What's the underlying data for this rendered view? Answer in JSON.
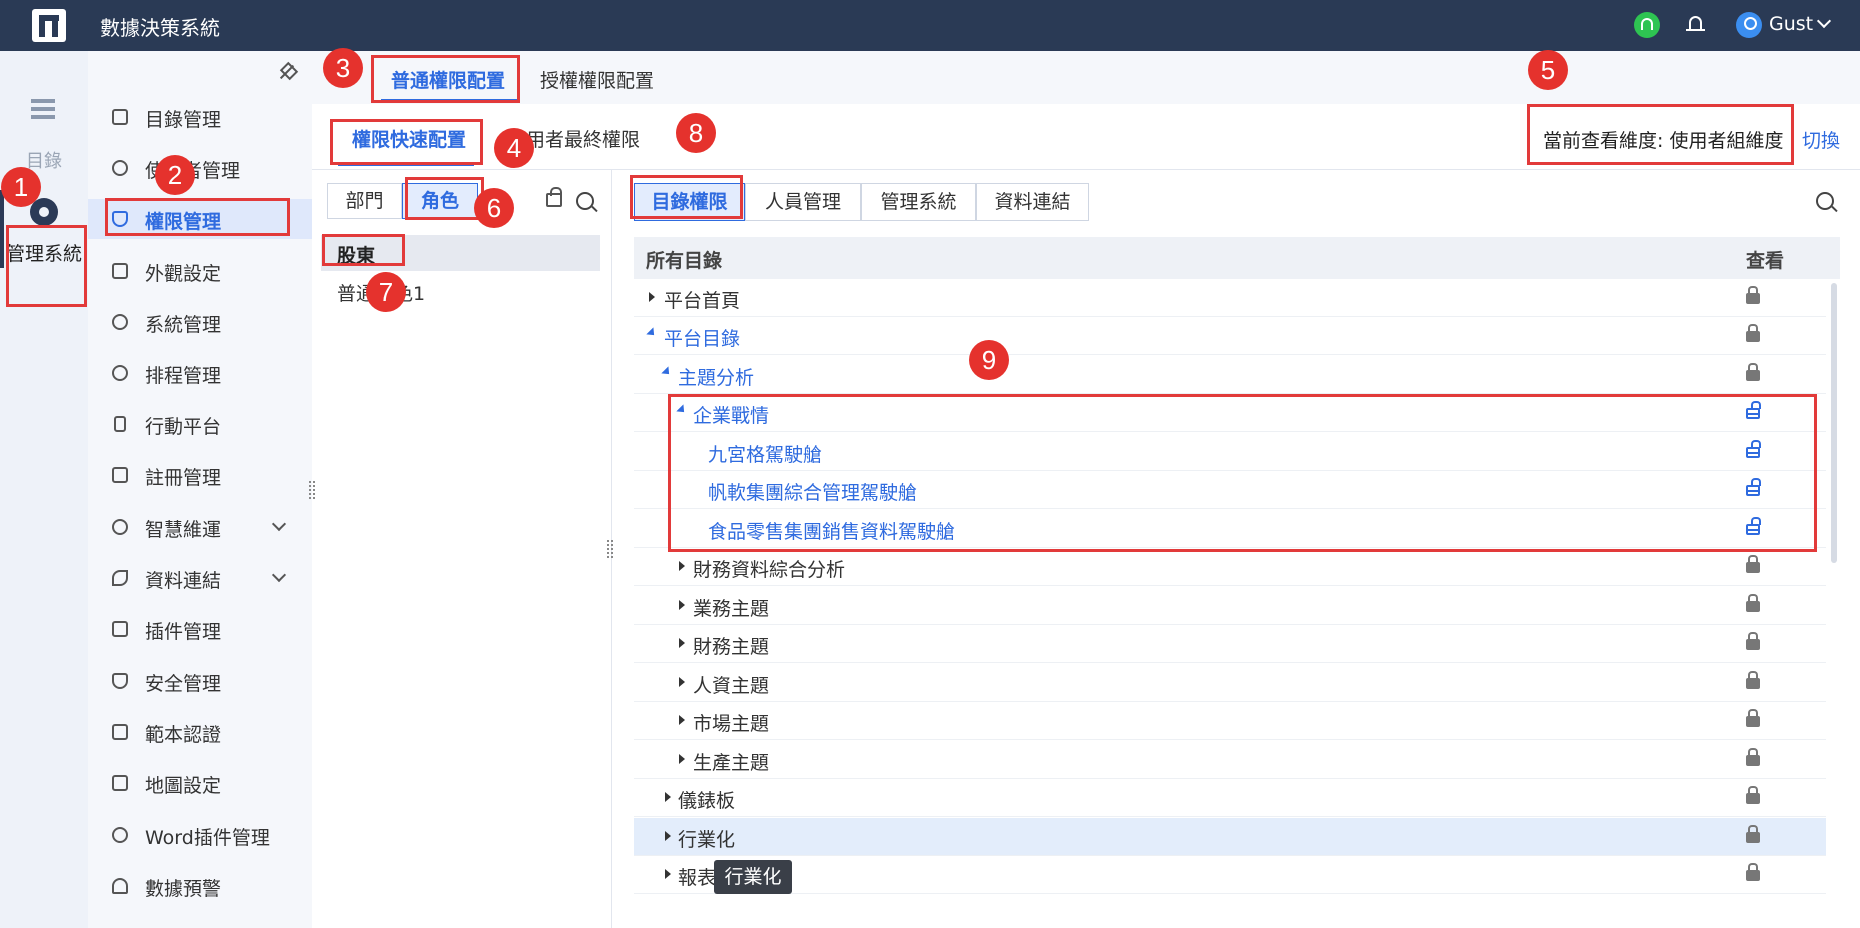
{
  "app": {
    "title": "數據決策系統",
    "user": "Gust"
  },
  "rail": {
    "directory_label": "目錄",
    "system_label": "管理系統"
  },
  "sidebar": {
    "items": [
      {
        "label": "目錄管理"
      },
      {
        "label": "使用者管理"
      },
      {
        "label": "權限管理",
        "active": true
      },
      {
        "label": "外觀設定"
      },
      {
        "label": "系統管理"
      },
      {
        "label": "排程管理"
      },
      {
        "label": "行動平台"
      },
      {
        "label": "註冊管理"
      },
      {
        "label": "智慧維運",
        "expandable": true
      },
      {
        "label": "資料連結",
        "expandable": true
      },
      {
        "label": "插件管理"
      },
      {
        "label": "安全管理"
      },
      {
        "label": "範本認證"
      },
      {
        "label": "地圖設定"
      },
      {
        "label": "Word插件管理"
      },
      {
        "label": "數據預警"
      }
    ]
  },
  "header": {
    "tabs": [
      "普通權限配置",
      "授權權限配置"
    ],
    "subtabs": [
      "權限快速配置",
      "使用者最終權限"
    ],
    "dimension_label": "當前查看維度: 使用者組維度",
    "switch_label": "切換"
  },
  "middle": {
    "segments": [
      "部門",
      "角色"
    ],
    "role_header": "股東",
    "roles": [
      "普通角色1"
    ]
  },
  "right": {
    "tabs": [
      "目錄權限",
      "人員管理",
      "管理系統",
      "資料連結"
    ],
    "columns": [
      "所有目錄",
      "查看"
    ],
    "rows": [
      {
        "label": "平台首頁",
        "level": 0,
        "state": "collapsed",
        "lock": "locked"
      },
      {
        "label": "平台目錄",
        "level": 0,
        "state": "expanded",
        "lock": "locked",
        "blue": true
      },
      {
        "label": "主題分析",
        "level": 1,
        "state": "expanded",
        "lock": "locked",
        "blue": true
      },
      {
        "label": "企業戰情",
        "level": 2,
        "state": "expanded",
        "lock": "open",
        "blue": true
      },
      {
        "label": "九宮格駕駛艙",
        "level": 3,
        "state": "leaf",
        "lock": "open",
        "blue": true
      },
      {
        "label": "帆軟集團綜合管理駕駛艙",
        "level": 3,
        "state": "leaf",
        "lock": "open",
        "blue": true
      },
      {
        "label": "食品零售集團銷售資料駕駛艙",
        "level": 3,
        "state": "leaf",
        "lock": "open",
        "blue": true
      },
      {
        "label": "財務資料綜合分析",
        "level": 2,
        "state": "collapsed",
        "lock": "locked"
      },
      {
        "label": "業務主題",
        "level": 2,
        "state": "collapsed",
        "lock": "locked"
      },
      {
        "label": "財務主題",
        "level": 2,
        "state": "collapsed",
        "lock": "locked"
      },
      {
        "label": "人資主題",
        "level": 2,
        "state": "collapsed",
        "lock": "locked"
      },
      {
        "label": "市場主題",
        "level": 2,
        "state": "collapsed",
        "lock": "locked"
      },
      {
        "label": "生產主題",
        "level": 2,
        "state": "collapsed",
        "lock": "locked"
      },
      {
        "label": "儀錶板",
        "level": 1,
        "state": "collapsed",
        "lock": "locked"
      },
      {
        "label": "行業化",
        "level": 1,
        "state": "collapsed",
        "lock": "locked",
        "hover": true
      },
      {
        "label": "報表",
        "level": 1,
        "state": "collapsed",
        "lock": "locked"
      }
    ],
    "tooltip": "行業化"
  },
  "annotations": [
    "1",
    "2",
    "3",
    "4",
    "5",
    "6",
    "7",
    "8",
    "9"
  ],
  "colors": {
    "topbar": "#2a3a55",
    "accent": "#2f6bdf",
    "annotation": "#e5322d"
  }
}
